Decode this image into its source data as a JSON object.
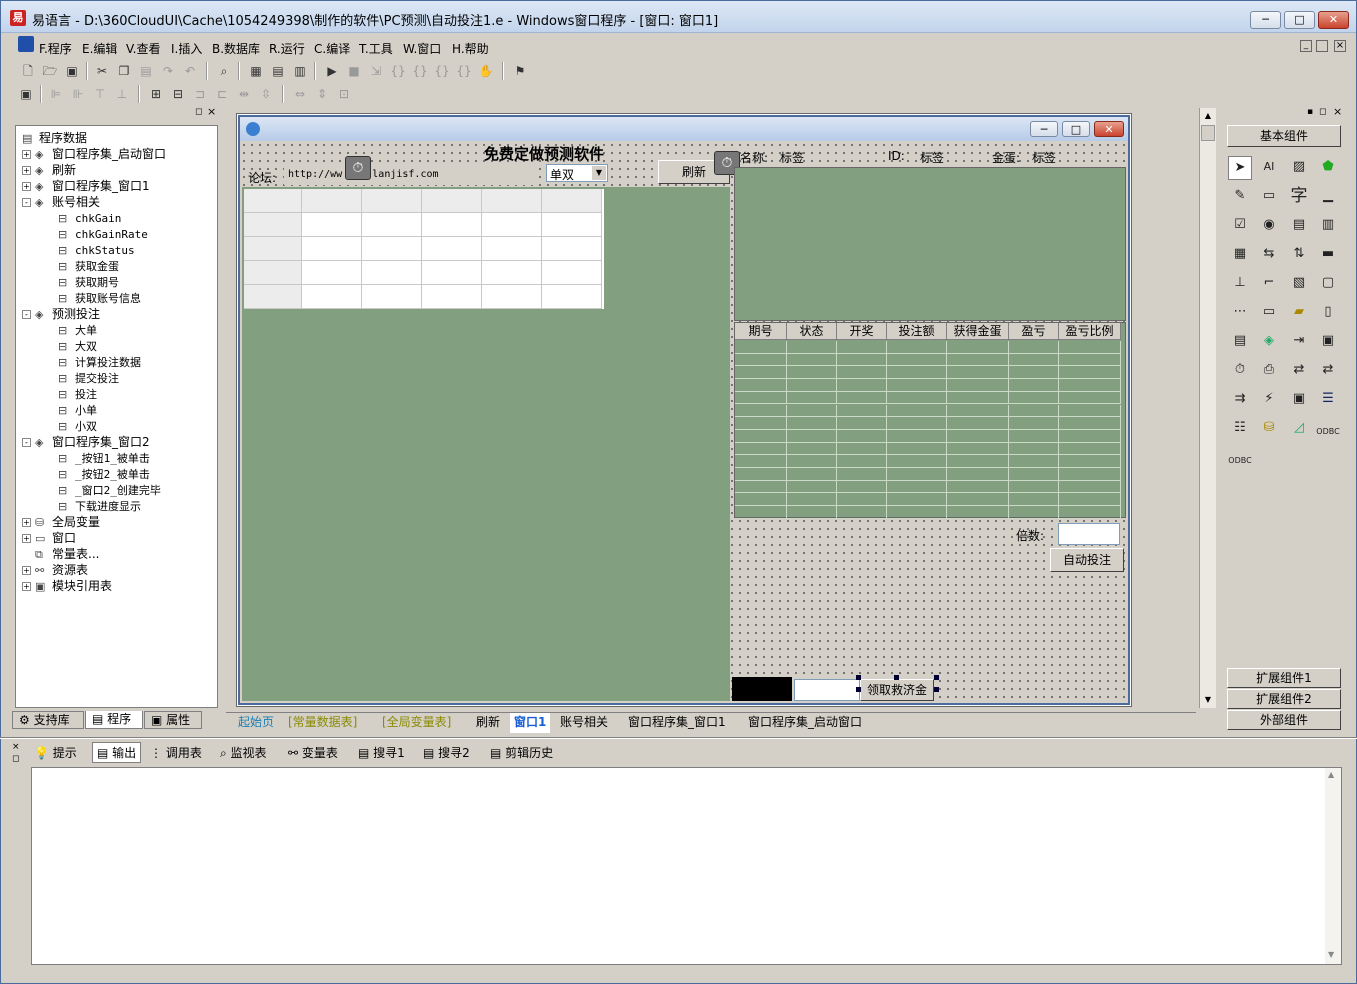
{
  "window": {
    "title": "易语言 - D:\\360CloudUI\\Cache\\1054249398\\制作的软件\\PC预测\\自动投注1.e - Windows窗口程序 - [窗口: 窗口1]",
    "app_icon": "易",
    "min": "─",
    "max": "□",
    "close": "✕"
  },
  "menu": [
    "F.程序",
    "E.编辑",
    "V.查看",
    "I.插入",
    "B.数据库",
    "R.运行",
    "C.编译",
    "T.工具",
    "W.窗口",
    "H.帮助"
  ],
  "left_panel": {
    "tree": [
      {
        "label": "程序数据",
        "level": 0,
        "icon": "doc-icon"
      },
      {
        "label": "窗口程序集_启动窗口",
        "level": 1,
        "exp": "+",
        "icon": "layers-icon"
      },
      {
        "label": "刷新",
        "level": 1,
        "exp": "+",
        "icon": "layers-icon"
      },
      {
        "label": "窗口程序集_窗口1",
        "level": 1,
        "exp": "+",
        "icon": "layers-icon"
      },
      {
        "label": "账号相关",
        "level": 1,
        "exp": "-",
        "icon": "layers-icon"
      },
      {
        "label": "chkGain",
        "level": 2,
        "icon": "sub-icon"
      },
      {
        "label": "chkGainRate",
        "level": 2,
        "icon": "sub-icon"
      },
      {
        "label": "chkStatus",
        "level": 2,
        "icon": "sub-icon"
      },
      {
        "label": "获取金蛋",
        "level": 2,
        "icon": "sub-icon"
      },
      {
        "label": "获取期号",
        "level": 2,
        "icon": "sub-icon"
      },
      {
        "label": "获取账号信息",
        "level": 2,
        "icon": "sub-icon"
      },
      {
        "label": "预测投注",
        "level": 1,
        "exp": "-",
        "icon": "layers-icon"
      },
      {
        "label": "大单",
        "level": 2,
        "icon": "sub-icon"
      },
      {
        "label": "大双",
        "level": 2,
        "icon": "sub-icon"
      },
      {
        "label": "计算投注数据",
        "level": 2,
        "icon": "sub-icon"
      },
      {
        "label": "提交投注",
        "level": 2,
        "icon": "sub-icon"
      },
      {
        "label": "投注",
        "level": 2,
        "icon": "sub-icon"
      },
      {
        "label": "小单",
        "level": 2,
        "icon": "sub-icon"
      },
      {
        "label": "小双",
        "level": 2,
        "icon": "sub-icon"
      },
      {
        "label": "窗口程序集_窗口2",
        "level": 1,
        "exp": "-",
        "icon": "layers-icon"
      },
      {
        "label": "_按钮1_被单击",
        "level": 2,
        "icon": "sub-icon"
      },
      {
        "label": "_按钮2_被单击",
        "level": 2,
        "icon": "sub-icon"
      },
      {
        "label": "_窗口2_创建完毕",
        "level": 2,
        "icon": "sub-icon"
      },
      {
        "label": "下载进度显示",
        "level": 2,
        "icon": "sub-icon"
      },
      {
        "label": "全局变量",
        "level": 1,
        "exp": "+",
        "icon": "db-icon"
      },
      {
        "label": "窗口",
        "level": 1,
        "exp": "+",
        "icon": "window-icon"
      },
      {
        "label": "常量表...",
        "level": 1,
        "icon": "const-icon"
      },
      {
        "label": "资源表",
        "level": 1,
        "exp": "+",
        "icon": "res-icon"
      },
      {
        "label": "模块引用表",
        "level": 1,
        "exp": "+",
        "icon": "module-icon"
      }
    ],
    "tabs": [
      "支持库",
      "程序",
      "属性"
    ]
  },
  "form": {
    "title": "免费定做预测软件",
    "forum_label": "论坛:",
    "forum_url": "http://ww     lanjisf.com",
    "combo_value": "单双",
    "refresh_button": "刷新",
    "name_label": "名称:",
    "name_value": "标签",
    "id_label": "ID:",
    "id_value": "标签",
    "gold_label": "金蛋:",
    "gold_value": "标签",
    "columns": [
      "期号",
      "状态",
      "开奖",
      "投注额",
      "获得金蛋",
      "盈亏",
      "盈亏比例"
    ],
    "multiplier_label": "倍数:",
    "auto_bet_button": "自动投注",
    "relief_button": "领取救济金"
  },
  "doc_tabs": [
    "起始页",
    "[常量数据表]",
    "[全局变量表]",
    "刷新",
    "窗口1",
    "账号相关",
    "窗口程序集_窗口1",
    "窗口程序集_启动窗口"
  ],
  "right_panel": {
    "basic_header": "基本组件",
    "component_a": "AI",
    "component_char": "字",
    "odbc_label": "ODBC",
    "buttons": [
      "扩展组件1",
      "扩展组件2",
      "外部组件"
    ]
  },
  "output_tabs": [
    "提示",
    "输出",
    "调用表",
    "监视表",
    "变量表",
    "搜寻1",
    "搜寻2",
    "剪辑历史"
  ]
}
